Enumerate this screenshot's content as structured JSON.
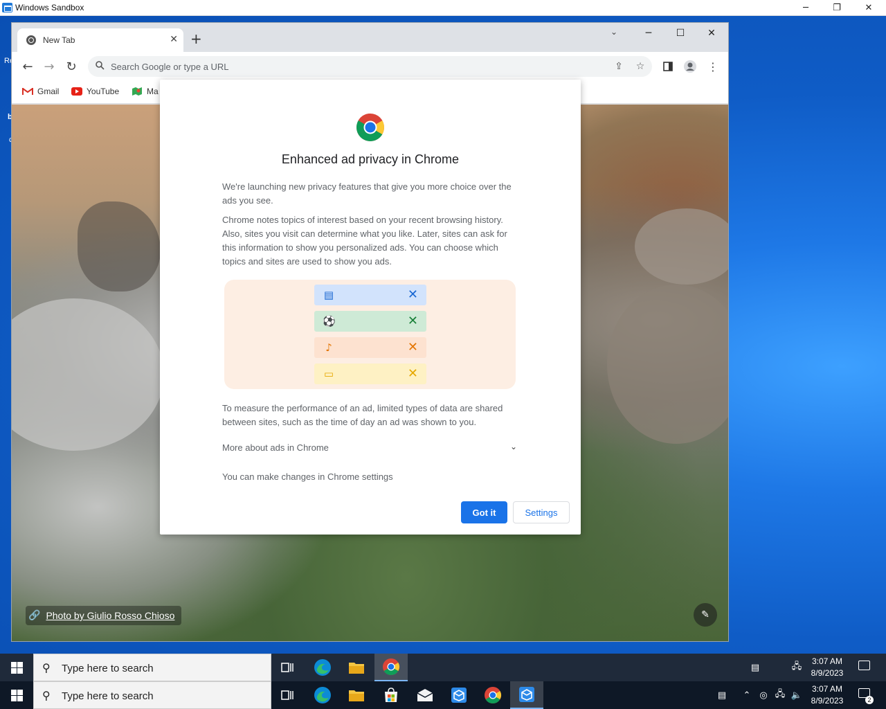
{
  "sandbox": {
    "title": "Windows Sandbox",
    "minimize": "─",
    "restore": "❐",
    "close": "✕"
  },
  "desktop": {
    "fragment_1": "Re",
    "fragment_2": "b",
    "fragment_3": "c"
  },
  "chrome": {
    "tab": {
      "title": "New Tab",
      "close": "✕"
    },
    "new_tab": "+",
    "tab_search": "⌄",
    "controls": {
      "minimize": "─",
      "maximize": "☐",
      "close": "✕"
    },
    "toolbar": {
      "back": "←",
      "forward": "→",
      "reload": "↻",
      "omnibox_placeholder": "Search Google or type a URL",
      "share": "⇪",
      "bookmark_star": "☆",
      "menu": "⋮"
    },
    "bookmarks": [
      {
        "label": "Gmail",
        "icon": "gmail-icon"
      },
      {
        "label": "YouTube",
        "icon": "youtube-icon"
      },
      {
        "label": "Ma",
        "icon": "maps-icon"
      }
    ],
    "ntp": {
      "photo_credit": "Photo by Giulio Rosso Chioso",
      "link_icon": "🔗",
      "customize_icon": "✎"
    }
  },
  "dialog": {
    "title": "Enhanced ad privacy in Chrome",
    "p1": "We're launching new privacy features that give you more choice over the ads you see.",
    "p2": "Chrome notes topics of interest based on your recent browsing history. Also, sites you visit can determine what you like. Later, sites can ask for this information to show you personalized ads. You can choose which topics and sites are used to show you ads.",
    "topics": [
      {
        "icon": "news-icon",
        "glyph": "▤",
        "color": "#1967d2",
        "bg": "#d2e3fc",
        "remove": "✕"
      },
      {
        "icon": "sports-icon",
        "glyph": "⚽",
        "color": "#188038",
        "bg": "#ceead6",
        "remove": "✕"
      },
      {
        "icon": "music-icon",
        "glyph": "♪",
        "color": "#e37400",
        "bg": "#fde2d0",
        "remove": "✕"
      },
      {
        "icon": "movies-icon",
        "glyph": "▭",
        "color": "#e6a800",
        "bg": "#fef1c4",
        "remove": "✕"
      }
    ],
    "p3": "To measure the performance of an ad, limited types of data are shared between sites, such as the time of day an ad was shown to you.",
    "more_label": "More about ads in Chrome",
    "more_chevron": "⌄",
    "settings_note": "You can make changes in Chrome settings",
    "primary_button": "Got it",
    "secondary_button": "Settings"
  },
  "taskbar_upper": {
    "search_placeholder": "Type here to search",
    "time": "3:07 AM",
    "date": "8/9/2023",
    "notif_count": ""
  },
  "taskbar_lower": {
    "search_placeholder": "Type here to search",
    "time": "3:07 AM",
    "date": "8/9/2023",
    "notif_count": "2"
  }
}
